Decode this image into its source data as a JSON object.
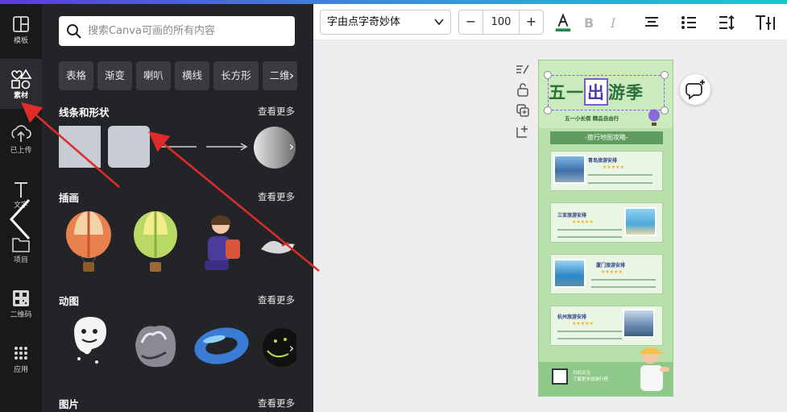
{
  "rail": {
    "items": [
      {
        "label": "模板",
        "icon": "template-icon"
      },
      {
        "label": "素材",
        "icon": "elements-icon"
      },
      {
        "label": "已上传",
        "icon": "upload-icon"
      },
      {
        "label": "文字",
        "icon": "text-icon"
      },
      {
        "label": "项目",
        "icon": "folder-icon"
      },
      {
        "label": "二维码",
        "icon": "qrcode-icon"
      },
      {
        "label": "应用",
        "icon": "apps-icon"
      }
    ]
  },
  "panel": {
    "search_placeholder": "搜索Canva可画的所有内容",
    "chips": [
      "表格",
      "渐变",
      "喇叭",
      "横线",
      "长方形",
      "二维"
    ],
    "sections": [
      {
        "title": "线条和形状",
        "more": "查看更多"
      },
      {
        "title": "插画",
        "more": "查看更多"
      },
      {
        "title": "动图",
        "more": "查看更多"
      },
      {
        "title": "图片",
        "more": "查看更多"
      }
    ]
  },
  "toolbar": {
    "font": "字由点字奇妙体",
    "font_size": "100",
    "minus": "−",
    "plus": "+"
  },
  "poster": {
    "title_a": "五一",
    "title_box": "出",
    "title_b": "游季",
    "subtitle": "五一小长假  精品自由行",
    "band": "-旅行地图攻略-",
    "cards": [
      {
        "title": "青岛旅游安排"
      },
      {
        "title": "三亚旅游安排"
      },
      {
        "title": "厦门旅游安排"
      },
      {
        "title": "杭州旅游安排"
      }
    ],
    "footer_line1": "扫码关注",
    "footer_line2": "了解更多旅游行程"
  },
  "colors": {
    "rail_bg": "#18191b",
    "panel_bg": "#232427",
    "poster_green": "#b9dfad",
    "arrow_red": "#e02b2b"
  }
}
